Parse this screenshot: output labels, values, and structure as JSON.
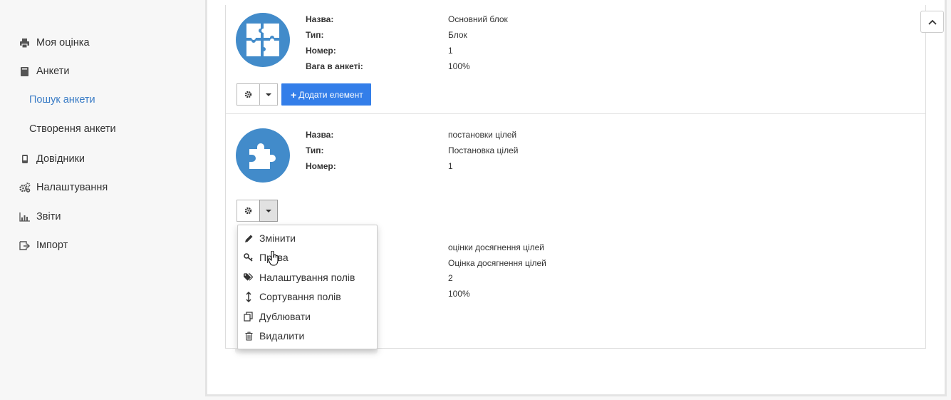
{
  "sidebar": {
    "items": [
      {
        "label": "Моя оцінка",
        "icon": "print-icon"
      },
      {
        "label": "Анкети",
        "icon": "book-icon"
      },
      {
        "label": "Пошук анкети",
        "sub": true,
        "active": true
      },
      {
        "label": "Створення анкети",
        "sub": true
      },
      {
        "label": "Довідники",
        "icon": "phone-icon"
      },
      {
        "label": "Налаштування",
        "icon": "gears-icon"
      },
      {
        "label": "Звіти",
        "icon": "chart-icon"
      },
      {
        "label": "Імпорт",
        "icon": "import-icon"
      }
    ]
  },
  "labels": {
    "name": "Назва:",
    "type": "Тип:",
    "number": "Номер:",
    "weight": "Вага в анкеті:"
  },
  "blocks": [
    {
      "name": "Основний блок",
      "type": "Блок",
      "number": "1",
      "weight": "100%",
      "add_label": "Додати елемент"
    },
    {
      "name": "постановки цілей",
      "type": "Постановка цілей",
      "number": "1"
    },
    {
      "name": "оцінки досягнення цілей",
      "type": "Оцінка досягнення цілей",
      "number": "2",
      "weight": "100%"
    }
  ],
  "menu": {
    "items": [
      {
        "label": "Змінити",
        "icon": "pencil-icon"
      },
      {
        "label": "Права",
        "icon": "key-icon"
      },
      {
        "label": "Налаштування полів",
        "icon": "tags-icon"
      },
      {
        "label": "Сортування полів",
        "icon": "sort-vertical-icon"
      },
      {
        "label": "Дублювати",
        "icon": "copy-icon"
      },
      {
        "label": "Видалити",
        "icon": "trash-icon"
      }
    ]
  },
  "colors": {
    "accent": "#428bca",
    "primary_button": "#337ee9",
    "active_link": "#3a7cc6"
  }
}
